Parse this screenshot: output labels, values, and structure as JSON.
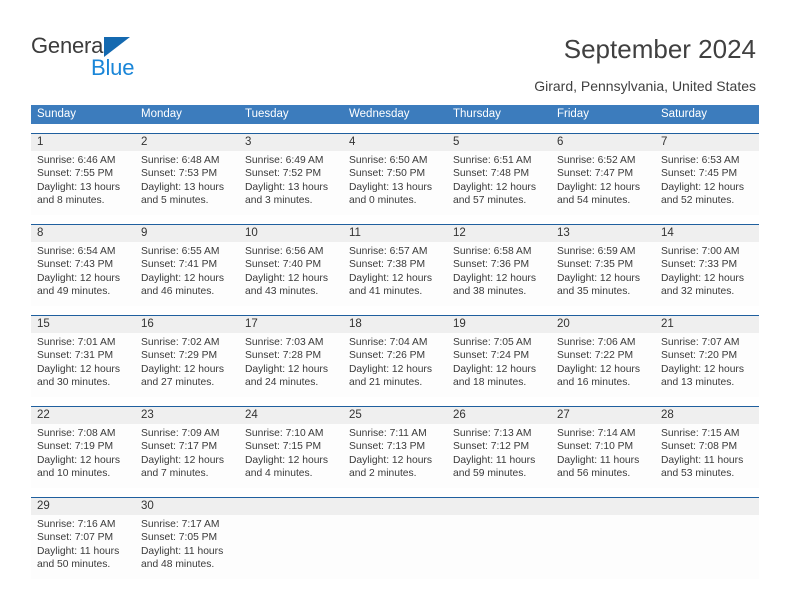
{
  "brand": {
    "name_part1": "General",
    "name_part2": "Blue",
    "accent_color": "#1469b0",
    "blue_color": "#1a86d8"
  },
  "header": {
    "title": "September 2024",
    "location": "Girard, Pennsylvania, United States"
  },
  "calendar": {
    "header_bg": "#3c7cbd",
    "weekdays": [
      "Sunday",
      "Monday",
      "Tuesday",
      "Wednesday",
      "Thursday",
      "Friday",
      "Saturday"
    ],
    "weeks": [
      [
        {
          "day": "1",
          "sunrise": "Sunrise: 6:46 AM",
          "sunset": "Sunset: 7:55 PM",
          "daylight": "Daylight: 13 hours and 8 minutes."
        },
        {
          "day": "2",
          "sunrise": "Sunrise: 6:48 AM",
          "sunset": "Sunset: 7:53 PM",
          "daylight": "Daylight: 13 hours and 5 minutes."
        },
        {
          "day": "3",
          "sunrise": "Sunrise: 6:49 AM",
          "sunset": "Sunset: 7:52 PM",
          "daylight": "Daylight: 13 hours and 3 minutes."
        },
        {
          "day": "4",
          "sunrise": "Sunrise: 6:50 AM",
          "sunset": "Sunset: 7:50 PM",
          "daylight": "Daylight: 13 hours and 0 minutes."
        },
        {
          "day": "5",
          "sunrise": "Sunrise: 6:51 AM",
          "sunset": "Sunset: 7:48 PM",
          "daylight": "Daylight: 12 hours and 57 minutes."
        },
        {
          "day": "6",
          "sunrise": "Sunrise: 6:52 AM",
          "sunset": "Sunset: 7:47 PM",
          "daylight": "Daylight: 12 hours and 54 minutes."
        },
        {
          "day": "7",
          "sunrise": "Sunrise: 6:53 AM",
          "sunset": "Sunset: 7:45 PM",
          "daylight": "Daylight: 12 hours and 52 minutes."
        }
      ],
      [
        {
          "day": "8",
          "sunrise": "Sunrise: 6:54 AM",
          "sunset": "Sunset: 7:43 PM",
          "daylight": "Daylight: 12 hours and 49 minutes."
        },
        {
          "day": "9",
          "sunrise": "Sunrise: 6:55 AM",
          "sunset": "Sunset: 7:41 PM",
          "daylight": "Daylight: 12 hours and 46 minutes."
        },
        {
          "day": "10",
          "sunrise": "Sunrise: 6:56 AM",
          "sunset": "Sunset: 7:40 PM",
          "daylight": "Daylight: 12 hours and 43 minutes."
        },
        {
          "day": "11",
          "sunrise": "Sunrise: 6:57 AM",
          "sunset": "Sunset: 7:38 PM",
          "daylight": "Daylight: 12 hours and 41 minutes."
        },
        {
          "day": "12",
          "sunrise": "Sunrise: 6:58 AM",
          "sunset": "Sunset: 7:36 PM",
          "daylight": "Daylight: 12 hours and 38 minutes."
        },
        {
          "day": "13",
          "sunrise": "Sunrise: 6:59 AM",
          "sunset": "Sunset: 7:35 PM",
          "daylight": "Daylight: 12 hours and 35 minutes."
        },
        {
          "day": "14",
          "sunrise": "Sunrise: 7:00 AM",
          "sunset": "Sunset: 7:33 PM",
          "daylight": "Daylight: 12 hours and 32 minutes."
        }
      ],
      [
        {
          "day": "15",
          "sunrise": "Sunrise: 7:01 AM",
          "sunset": "Sunset: 7:31 PM",
          "daylight": "Daylight: 12 hours and 30 minutes."
        },
        {
          "day": "16",
          "sunrise": "Sunrise: 7:02 AM",
          "sunset": "Sunset: 7:29 PM",
          "daylight": "Daylight: 12 hours and 27 minutes."
        },
        {
          "day": "17",
          "sunrise": "Sunrise: 7:03 AM",
          "sunset": "Sunset: 7:28 PM",
          "daylight": "Daylight: 12 hours and 24 minutes."
        },
        {
          "day": "18",
          "sunrise": "Sunrise: 7:04 AM",
          "sunset": "Sunset: 7:26 PM",
          "daylight": "Daylight: 12 hours and 21 minutes."
        },
        {
          "day": "19",
          "sunrise": "Sunrise: 7:05 AM",
          "sunset": "Sunset: 7:24 PM",
          "daylight": "Daylight: 12 hours and 18 minutes."
        },
        {
          "day": "20",
          "sunrise": "Sunrise: 7:06 AM",
          "sunset": "Sunset: 7:22 PM",
          "daylight": "Daylight: 12 hours and 16 minutes."
        },
        {
          "day": "21",
          "sunrise": "Sunrise: 7:07 AM",
          "sunset": "Sunset: 7:20 PM",
          "daylight": "Daylight: 12 hours and 13 minutes."
        }
      ],
      [
        {
          "day": "22",
          "sunrise": "Sunrise: 7:08 AM",
          "sunset": "Sunset: 7:19 PM",
          "daylight": "Daylight: 12 hours and 10 minutes."
        },
        {
          "day": "23",
          "sunrise": "Sunrise: 7:09 AM",
          "sunset": "Sunset: 7:17 PM",
          "daylight": "Daylight: 12 hours and 7 minutes."
        },
        {
          "day": "24",
          "sunrise": "Sunrise: 7:10 AM",
          "sunset": "Sunset: 7:15 PM",
          "daylight": "Daylight: 12 hours and 4 minutes."
        },
        {
          "day": "25",
          "sunrise": "Sunrise: 7:11 AM",
          "sunset": "Sunset: 7:13 PM",
          "daylight": "Daylight: 12 hours and 2 minutes."
        },
        {
          "day": "26",
          "sunrise": "Sunrise: 7:13 AM",
          "sunset": "Sunset: 7:12 PM",
          "daylight": "Daylight: 11 hours and 59 minutes."
        },
        {
          "day": "27",
          "sunrise": "Sunrise: 7:14 AM",
          "sunset": "Sunset: 7:10 PM",
          "daylight": "Daylight: 11 hours and 56 minutes."
        },
        {
          "day": "28",
          "sunrise": "Sunrise: 7:15 AM",
          "sunset": "Sunset: 7:08 PM",
          "daylight": "Daylight: 11 hours and 53 minutes."
        }
      ],
      [
        {
          "day": "29",
          "sunrise": "Sunrise: 7:16 AM",
          "sunset": "Sunset: 7:07 PM",
          "daylight": "Daylight: 11 hours and 50 minutes."
        },
        {
          "day": "30",
          "sunrise": "Sunrise: 7:17 AM",
          "sunset": "Sunset: 7:05 PM",
          "daylight": "Daylight: 11 hours and 48 minutes."
        },
        {
          "day": "",
          "sunrise": "",
          "sunset": "",
          "daylight": ""
        },
        {
          "day": "",
          "sunrise": "",
          "sunset": "",
          "daylight": ""
        },
        {
          "day": "",
          "sunrise": "",
          "sunset": "",
          "daylight": ""
        },
        {
          "day": "",
          "sunrise": "",
          "sunset": "",
          "daylight": ""
        },
        {
          "day": "",
          "sunrise": "",
          "sunset": "",
          "daylight": ""
        }
      ]
    ]
  }
}
